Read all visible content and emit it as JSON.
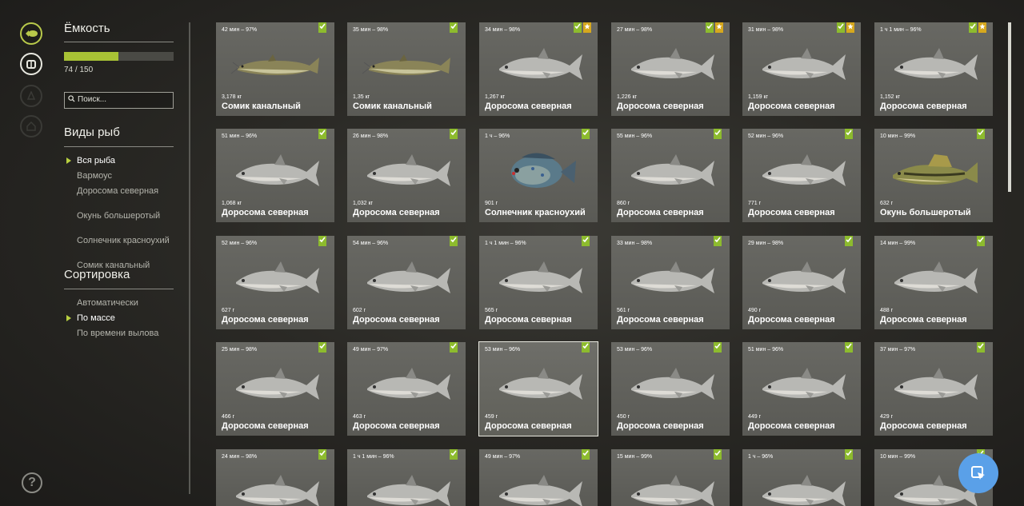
{
  "capacity": {
    "title": "Ёмкость",
    "current": 74,
    "max": 150,
    "text": "74 / 150"
  },
  "search": {
    "placeholder": "Поиск..."
  },
  "species": {
    "title": "Виды рыб",
    "items": [
      {
        "label": "Вся рыба",
        "selected": true
      },
      {
        "label": "Вармоус",
        "selected": false
      },
      {
        "label": "Доросома северная",
        "selected": false
      },
      {
        "label": "Окунь большеротый",
        "selected": false
      },
      {
        "label": "Солнечник красноухий",
        "selected": false
      },
      {
        "label": "Сомик канальный",
        "selected": false
      }
    ]
  },
  "sort": {
    "title": "Сортировка",
    "items": [
      {
        "label": "Автоматически",
        "selected": false
      },
      {
        "label": "По массе",
        "selected": true
      },
      {
        "label": "По времени вылова",
        "selected": false
      }
    ]
  },
  "icons": {
    "rail": [
      "fish-icon",
      "keepnet-icon",
      "campfire-icon",
      "home-icon"
    ],
    "help": "help-icon",
    "fab": "cursor-icon"
  },
  "help_label": "?",
  "colors": {
    "accent": "#a8c235",
    "badge_green": "#8dbb2e",
    "badge_gold": "#d6a81e",
    "fab": "#5aa0e8"
  },
  "catches": [
    {
      "time": "42 мин – 97%",
      "weight": "3,178 кг",
      "name": "Сомик канальный",
      "type": "catfish",
      "badges": [
        "green"
      ]
    },
    {
      "time": "35 мин – 98%",
      "weight": "1,35 кг",
      "name": "Сомик канальный",
      "type": "catfish",
      "badges": [
        "green"
      ]
    },
    {
      "time": "34 мин – 98%",
      "weight": "1,267 кг",
      "name": "Доросома северная",
      "type": "shad",
      "badges": [
        "green",
        "gold"
      ]
    },
    {
      "time": "27 мин – 98%",
      "weight": "1,226 кг",
      "name": "Доросома северная",
      "type": "shad",
      "badges": [
        "green",
        "gold"
      ]
    },
    {
      "time": "31 мин – 98%",
      "weight": "1,159 кг",
      "name": "Доросома северная",
      "type": "shad",
      "badges": [
        "green",
        "gold"
      ]
    },
    {
      "time": "1 ч 1 мин – 96%",
      "weight": "1,152 кг",
      "name": "Доросома северная",
      "type": "shad",
      "badges": [
        "green",
        "gold"
      ]
    },
    {
      "time": "51 мин – 96%",
      "weight": "1,068 кг",
      "name": "Доросома северная",
      "type": "shad",
      "badges": [
        "green"
      ]
    },
    {
      "time": "26 мин – 98%",
      "weight": "1,032 кг",
      "name": "Доросома северная",
      "type": "shad",
      "badges": [
        "green"
      ]
    },
    {
      "time": "1 ч – 96%",
      "weight": "901 г",
      "name": "Солнечник красноухий",
      "type": "sunfish",
      "badges": [
        "green"
      ]
    },
    {
      "time": "55 мин – 96%",
      "weight": "860 г",
      "name": "Доросома северная",
      "type": "shad",
      "badges": [
        "green"
      ]
    },
    {
      "time": "52 мин – 96%",
      "weight": "771 г",
      "name": "Доросома северная",
      "type": "shad",
      "badges": [
        "green"
      ]
    },
    {
      "time": "10 мин – 99%",
      "weight": "632 г",
      "name": "Окунь большеротый",
      "type": "bass",
      "badges": [
        "green"
      ]
    },
    {
      "time": "52 мин – 96%",
      "weight": "627 г",
      "name": "Доросома северная",
      "type": "shad",
      "badges": [
        "green"
      ]
    },
    {
      "time": "54 мин – 96%",
      "weight": "602 г",
      "name": "Доросома северная",
      "type": "shad",
      "badges": [
        "green"
      ]
    },
    {
      "time": "1 ч 1 мин – 96%",
      "weight": "565 г",
      "name": "Доросома северная",
      "type": "shad",
      "badges": [
        "green"
      ]
    },
    {
      "time": "33 мин – 98%",
      "weight": "561 г",
      "name": "Доросома северная",
      "type": "shad",
      "badges": [
        "green"
      ]
    },
    {
      "time": "29 мин – 98%",
      "weight": "490 г",
      "name": "Доросома северная",
      "type": "shad",
      "badges": [
        "green"
      ]
    },
    {
      "time": "14 мин – 99%",
      "weight": "488 г",
      "name": "Доросома северная",
      "type": "shad",
      "badges": [
        "green"
      ]
    },
    {
      "time": "25 мин – 98%",
      "weight": "466 г",
      "name": "Доросома северная",
      "type": "shad",
      "badges": [
        "green"
      ]
    },
    {
      "time": "49 мин – 97%",
      "weight": "463 г",
      "name": "Доросома северная",
      "type": "shad",
      "badges": [
        "green"
      ]
    },
    {
      "time": "53 мин – 96%",
      "weight": "459 г",
      "name": "Доросома северная",
      "type": "shad",
      "badges": [
        "green"
      ],
      "selected": true
    },
    {
      "time": "53 мин – 96%",
      "weight": "450 г",
      "name": "Доросома северная",
      "type": "shad",
      "badges": [
        "green"
      ]
    },
    {
      "time": "51 мин – 96%",
      "weight": "449 г",
      "name": "Доросома северная",
      "type": "shad",
      "badges": [
        "green"
      ]
    },
    {
      "time": "37 мин – 97%",
      "weight": "429 г",
      "name": "Доросома северная",
      "type": "shad",
      "badges": [
        "green"
      ]
    },
    {
      "time": "24 мин – 98%",
      "weight": "",
      "name": "",
      "type": "shad",
      "badges": [
        "green"
      ]
    },
    {
      "time": "1 ч 1 мин – 96%",
      "weight": "",
      "name": "",
      "type": "shad",
      "badges": [
        "green"
      ]
    },
    {
      "time": "49 мин – 97%",
      "weight": "",
      "name": "",
      "type": "shad",
      "badges": [
        "green"
      ]
    },
    {
      "time": "15 мин – 99%",
      "weight": "",
      "name": "",
      "type": "shad",
      "badges": [
        "green"
      ]
    },
    {
      "time": "1 ч – 96%",
      "weight": "",
      "name": "",
      "type": "shad",
      "badges": [
        "green"
      ]
    },
    {
      "time": "10 мин – 99%",
      "weight": "",
      "name": "",
      "type": "shad",
      "badges": [
        "green"
      ]
    }
  ]
}
